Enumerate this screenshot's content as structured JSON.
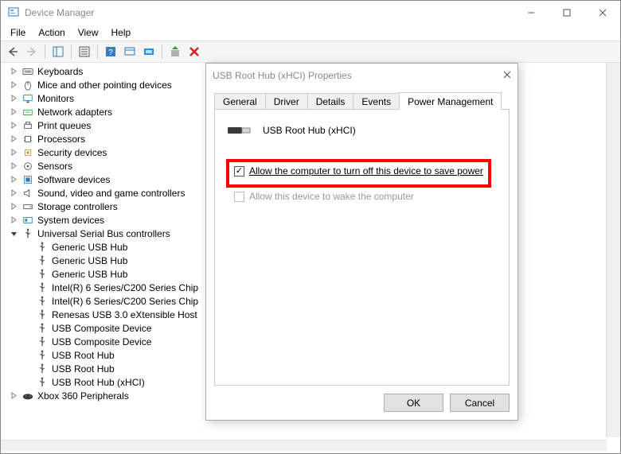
{
  "window": {
    "title": "Device Manager"
  },
  "menu": {
    "file": "File",
    "action": "Action",
    "view": "View",
    "help": "Help"
  },
  "tree": {
    "nodes": [
      {
        "label": "Keyboards",
        "icon": "keyboard"
      },
      {
        "label": "Mice and other pointing devices",
        "icon": "mouse"
      },
      {
        "label": "Monitors",
        "icon": "monitor"
      },
      {
        "label": "Network adapters",
        "icon": "network"
      },
      {
        "label": "Print queues",
        "icon": "printer"
      },
      {
        "label": "Processors",
        "icon": "cpu"
      },
      {
        "label": "Security devices",
        "icon": "security"
      },
      {
        "label": "Sensors",
        "icon": "sensor"
      },
      {
        "label": "Software devices",
        "icon": "software"
      },
      {
        "label": "Sound, video and game controllers",
        "icon": "sound"
      },
      {
        "label": "Storage controllers",
        "icon": "storage"
      },
      {
        "label": "System devices",
        "icon": "system"
      }
    ],
    "usb_label": "Universal Serial Bus controllers",
    "usb_children": [
      "Generic USB Hub",
      "Generic USB Hub",
      "Generic USB Hub",
      "Intel(R) 6 Series/C200 Series Chip",
      "Intel(R) 6 Series/C200 Series Chip",
      "Renesas USB 3.0 eXtensible Host",
      "USB Composite Device",
      "USB Composite Device",
      "USB Root Hub",
      "USB Root Hub",
      "USB Root Hub (xHCI)"
    ],
    "xbox_label": "Xbox 360 Peripherals"
  },
  "dialog": {
    "title": "USB Root Hub (xHCI) Properties",
    "tabs": {
      "general": "General",
      "driver": "Driver",
      "details": "Details",
      "events": "Events",
      "power": "Power Management"
    },
    "device_name": "USB Root Hub (xHCI)",
    "checkbox1_label": "Allow the computer to turn off this device to save power",
    "checkbox2_label": "Allow this device to wake the computer",
    "ok": "OK",
    "cancel": "Cancel"
  }
}
